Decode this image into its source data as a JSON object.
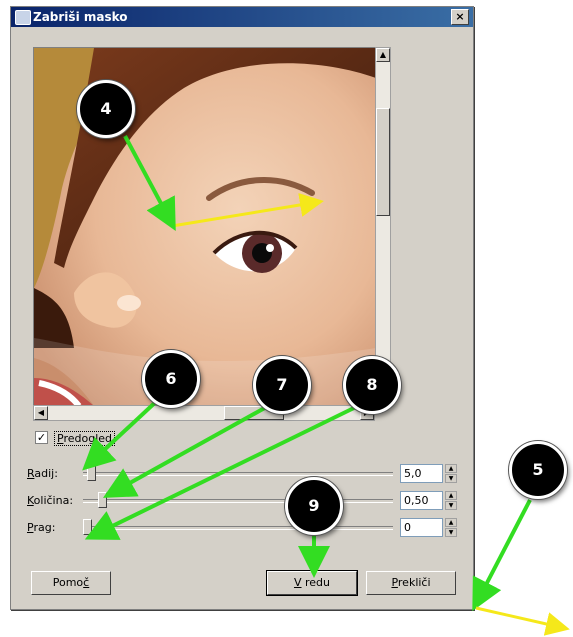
{
  "dialog": {
    "title": "Zabriši masko",
    "close_glyph": "×"
  },
  "preview": {
    "checkbox_checked": true,
    "checkbox_label_prefix": "",
    "checkbox_label_mnemonic": "P",
    "checkbox_label_rest": "redogled"
  },
  "sliders": [
    {
      "label_mnemonic": "R",
      "label_rest": "adij:",
      "value": "5,0"
    },
    {
      "label_mnemonic": "K",
      "label_rest": "oličina:",
      "value": "0,50"
    },
    {
      "label_mnemonic": "P",
      "label_rest": "rag:",
      "value": "0"
    }
  ],
  "buttons": {
    "help_prefix": "Pomo",
    "help_mnemonic": "č",
    "ok_mnemonic": "V",
    "ok_rest": " redu",
    "cancel_mnemonic": "P",
    "cancel_rest": "rekliči"
  },
  "callouts": [
    "4",
    "5",
    "6",
    "7",
    "8",
    "9"
  ],
  "colors": {
    "arrow_green": "#33dd22",
    "arrow_yellow": "#f5e81a",
    "callout_bg": "#000000"
  },
  "icons": [
    "app-icon",
    "close-icon",
    "scroll-up-icon",
    "scroll-left-icon",
    "scroll-right-icon",
    "spin-up-icon",
    "spin-down-icon",
    "check-icon"
  ]
}
